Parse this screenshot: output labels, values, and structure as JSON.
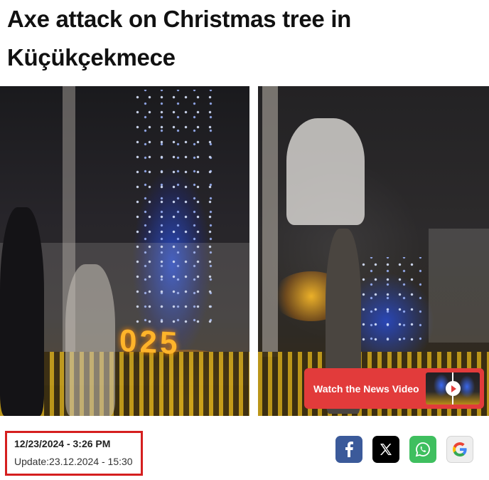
{
  "article": {
    "title": "Axe attack on Christmas tree in Küçükçekmece"
  },
  "media": {
    "left_photo": {
      "sign_text": "025"
    },
    "video_cta": {
      "label": "Watch the News Video"
    }
  },
  "meta": {
    "published": "12/23/2024 - 3:26 PM",
    "updated": "Update:23.12.2024 - 15:30",
    "highlight_color": "#d51f1f"
  },
  "share": {
    "buttons": [
      {
        "network": "facebook",
        "icon": "facebook-icon",
        "color": "#3b5a9a"
      },
      {
        "network": "x",
        "icon": "x-icon",
        "color": "#000000"
      },
      {
        "network": "whatsapp",
        "icon": "whatsapp-icon",
        "color": "#3fbf5f"
      },
      {
        "network": "google",
        "icon": "google-icon",
        "color": "#eeeeee"
      }
    ]
  },
  "colors": {
    "cta_red": "#e23b3b",
    "text": "#111111"
  }
}
